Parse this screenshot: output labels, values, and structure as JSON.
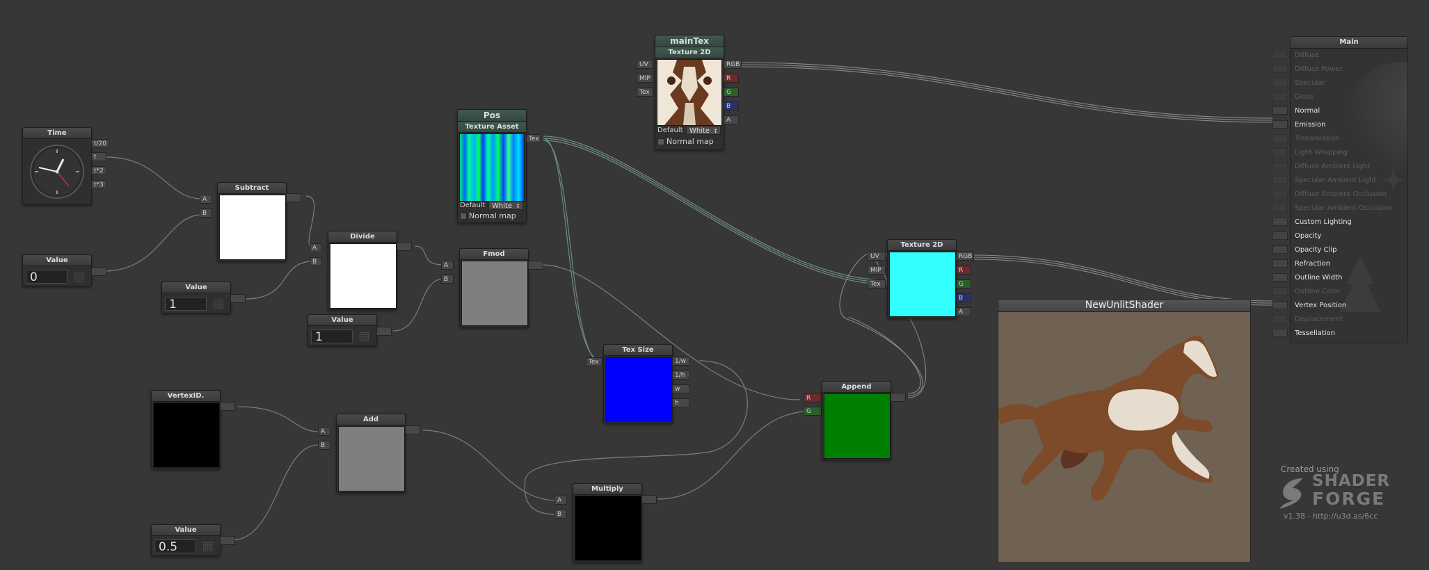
{
  "nodes": {
    "time": {
      "title": "Time",
      "outputs": [
        "t/20",
        "t",
        "t*2",
        "t*3"
      ]
    },
    "value0": {
      "title": "Value",
      "value": "0"
    },
    "subtract": {
      "title": "Subtract",
      "inputs": [
        "A",
        "B"
      ],
      "preview_color": "#ffffff"
    },
    "value1a": {
      "title": "Value",
      "value": "1"
    },
    "divide": {
      "title": "Divide",
      "inputs": [
        "A",
        "B"
      ],
      "preview_color": "#ffffff"
    },
    "value1b": {
      "title": "Value",
      "value": "1"
    },
    "pos": {
      "title": "Pos",
      "subtitle": "Texture Asset",
      "output": "Tex",
      "default_label": "Default",
      "default_value": "White",
      "normal_map_label": "Normal map"
    },
    "fmod": {
      "title": "Fmod",
      "inputs": [
        "A",
        "B"
      ],
      "preview_color": "#7f7f7f"
    },
    "maintex": {
      "title": "mainTex",
      "subtitle": "Texture 2D",
      "inputs": [
        "UV",
        "MIP",
        "Tex"
      ],
      "outputs": [
        "RGB",
        "R",
        "G",
        "B",
        "A"
      ],
      "default_label": "Default",
      "default_value": "White",
      "normal_map_label": "Normal map"
    },
    "texsize": {
      "title": "Tex Size",
      "input": "Tex",
      "outputs": [
        "1/w",
        "1/h",
        "w",
        "h"
      ],
      "preview_color": "#0000ff"
    },
    "tex2d": {
      "title": "Texture 2D",
      "inputs": [
        "UV",
        "MIP",
        "Tex"
      ],
      "outputs": [
        "RGB",
        "R",
        "G",
        "B",
        "A"
      ],
      "preview_color": "#33ffff"
    },
    "vertexid": {
      "title": "VertexID.",
      "preview_color": "#000000"
    },
    "add": {
      "title": "Add",
      "inputs": [
        "A",
        "B"
      ],
      "preview_color": "#7f7f7f"
    },
    "value05": {
      "title": "Value",
      "value": "0.5"
    },
    "multiply": {
      "title": "Multiply",
      "inputs": [
        "A",
        "B"
      ],
      "preview_color": "#000000"
    },
    "append": {
      "title": "Append",
      "inputs": [
        "R",
        "G"
      ],
      "preview_color": "#008000"
    }
  },
  "main_panel": {
    "title": "Main",
    "rows": [
      {
        "label": "Diffuse",
        "active": false
      },
      {
        "label": "Diffuse Power",
        "active": false
      },
      {
        "label": "Specular",
        "active": false
      },
      {
        "label": "Gloss",
        "active": false
      },
      {
        "label": "Normal",
        "active": true
      },
      {
        "label": "Emission",
        "active": true
      },
      {
        "label": "Transmission",
        "active": false
      },
      {
        "label": "Light Wrapping",
        "active": false
      },
      {
        "label": "Diffuse Ambient Light",
        "active": false
      },
      {
        "label": "Specular Ambient Light",
        "active": false
      },
      {
        "label": "Diffuse Ambient Occlusion",
        "active": false
      },
      {
        "label": "Specular Ambient Occlusion",
        "active": false
      },
      {
        "label": "Custom Lighting",
        "active": true
      },
      {
        "label": "Opacity",
        "active": true
      },
      {
        "label": "Opacity Clip",
        "active": true
      },
      {
        "label": "Refraction",
        "active": true
      },
      {
        "label": "Outline Width",
        "active": true
      },
      {
        "label": "Outline Color",
        "active": false
      },
      {
        "label": "Vertex Position",
        "active": true
      },
      {
        "label": "Displacement",
        "active": false
      },
      {
        "label": "Tessellation",
        "active": true
      }
    ]
  },
  "viewport": {
    "title": "NewUnlitShader"
  },
  "branding": {
    "created_using": "Created using",
    "logo_line1": "SHADER",
    "logo_line2": "FORGE",
    "version": "v1.38 - http://u3d.as/6cc"
  },
  "colors": {
    "canvas_bg": "#373737",
    "node_bg": "#2f2f2f",
    "wire": "#8a8a8a",
    "tex_wire": "#6d8c80"
  }
}
